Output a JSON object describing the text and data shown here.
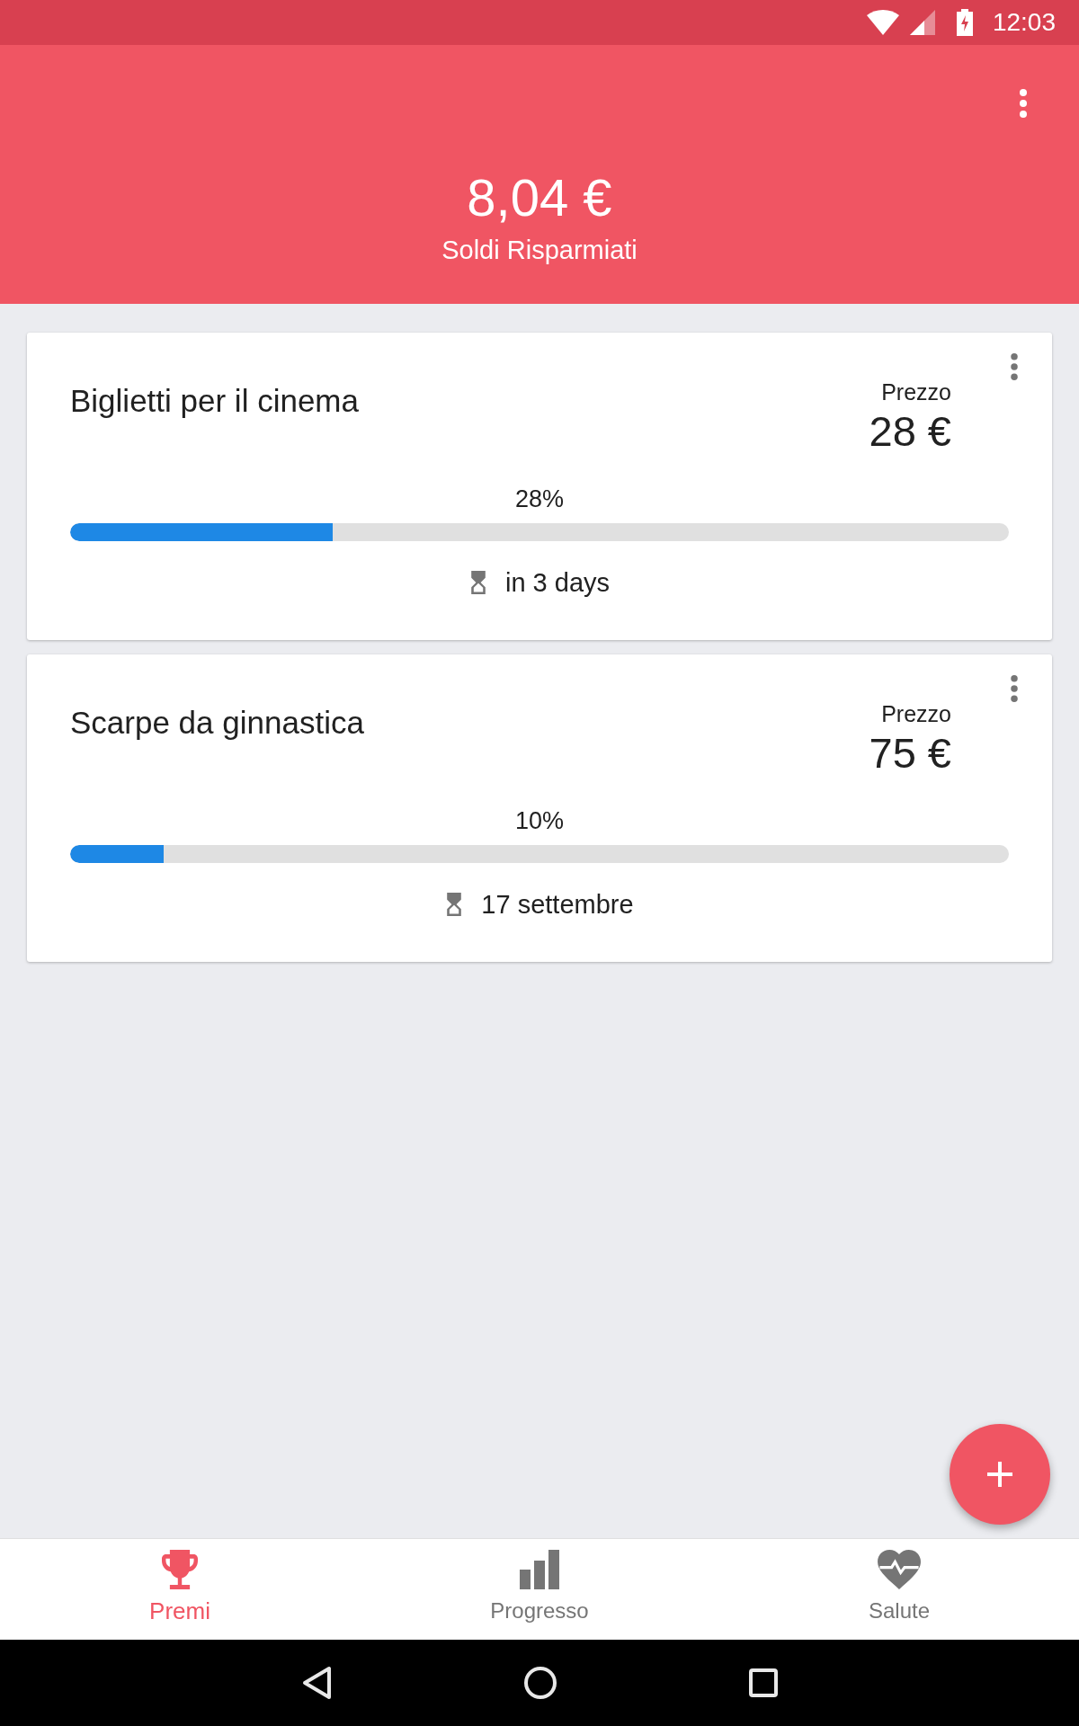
{
  "status_bar": {
    "time": "12:03"
  },
  "header": {
    "amount": "8,04 €",
    "caption": "Soldi Risparmiati"
  },
  "rewards": [
    {
      "title": "Biglietti per il cinema",
      "price_label": "Prezzo",
      "price": "28 €",
      "percent": "28%",
      "level": 0.28,
      "deadline": "in 3 days"
    },
    {
      "title": "Scarpe da ginnastica",
      "price_label": "Prezzo",
      "price": "75 €",
      "percent": "10%",
      "level": 0.1,
      "deadline": "17 settembre"
    }
  ],
  "bottom_nav": [
    {
      "label": "Premi",
      "selected": true
    },
    {
      "label": "Progresso",
      "selected": false
    },
    {
      "label": "Salute",
      "selected": false
    }
  ]
}
